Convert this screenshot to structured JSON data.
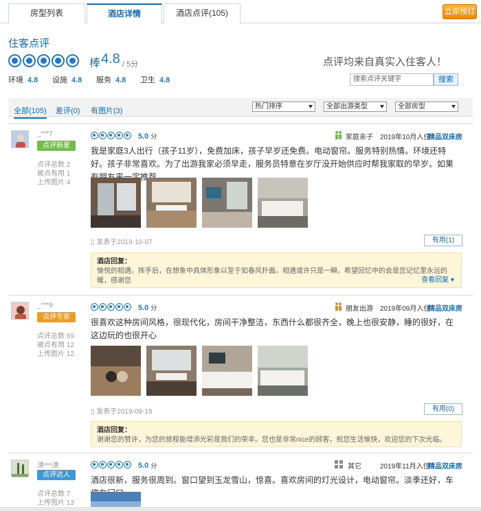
{
  "tabs": [
    "房型列表",
    "酒店详情",
    "酒店点评(105)"
  ],
  "book_button": "立即预订",
  "section_title": "住客点评",
  "rating": {
    "word": "棒",
    "value": "4.8",
    "max": "/ 5分"
  },
  "subscores": [
    {
      "label": "环境",
      "value": "4.8"
    },
    {
      "label": "设施",
      "value": "4.8"
    },
    {
      "label": "服务",
      "value": "4.8"
    },
    {
      "label": "卫生",
      "value": "4.8"
    }
  ],
  "real_note": "点评均来自真实入住客人！",
  "search": {
    "placeholder": "搜索点评关键字",
    "button": "搜索"
  },
  "filters": {
    "tabs": [
      "全部(105)",
      "差评(0)",
      "有图片(3)"
    ],
    "selects": [
      "热门排序",
      "全部出游类型",
      "全部房型"
    ]
  },
  "reviews": [
    {
      "user": "_***7",
      "badge": "点评新星",
      "badge_color": "#6fbf4a",
      "stats": [
        "点评总数 2",
        "被点有用 1",
        "上传图片 4"
      ],
      "score": "5.0",
      "score_unit": "分",
      "trip_type": "家庭亲子",
      "stay": "2019年10月入住",
      "room": "精品双床房",
      "content": "我是家庭3人出行（孩子11岁），免费加床，孩子早岁还免费。电动窗帘。服务特别热情。环境还特好。孩子非常喜欢。为了出游我家必须早走，服务员特意在岁厅没开始供应时帮我家取的早岁。如果有朋友来一定推荐。",
      "posted": "发表于2019-10-07",
      "useful": "有用(1)",
      "reply_title": "酒店回复：",
      "reply": "愉悦的相遇，挥手后，在想象中具体形象以至于如春风扑面。相遇或许只是一瞬，希望回忆中的会是您记忆里永远的暖，感谢您",
      "reply_more": "查看回复"
    },
    {
      "user": "_***9",
      "badge": "点评专家",
      "badge_color": "#f29a23",
      "stats": [
        "点评总数 69",
        "被点有用 12",
        "上传图片 12"
      ],
      "score": "5.0",
      "score_unit": "分",
      "trip_type": "朋友出游",
      "stay": "2019年09月入住",
      "room": "精品双床房",
      "content": "很喜欢这种房间风格，很现代化，房间干净整洁，东西什么都很齐全，晚上也很安静，睡的很好，在这边玩的也很开心",
      "posted": "发表于2019-09-19",
      "useful": "有用(0)",
      "reply_title": "酒店回复：",
      "reply": "谢谢您的赞许，为您的旅程能增添光彩是我们的荣幸。您也是非常nice的顾客，祝您生活愉快，欢迎您的下次光临。"
    },
    {
      "user": "漂***漂",
      "badge": "点评达人",
      "badge_color": "#3d98d9",
      "stats": [
        "点评总数 7",
        "上传图片 13"
      ],
      "score": "5.0",
      "score_unit": "分",
      "trip_type": "其它",
      "stay": "2019年11月入住",
      "room": "精品双床房",
      "content": "酒店很新，服务很周到。窗口望到玉龙雪山，惊喜。喜欢房间的灯光设计，电动窗帘。淡季还好，车停在门口。"
    }
  ],
  "colors": {
    "accent": "#1b7ad0",
    "orange": "#f08a00"
  }
}
